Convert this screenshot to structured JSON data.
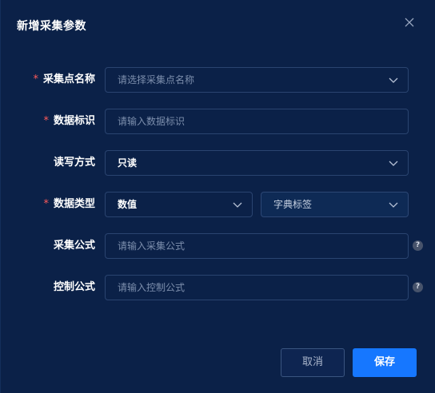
{
  "dialog": {
    "title": "新增采集参数",
    "close_icon": "close-icon"
  },
  "form": {
    "collect_point": {
      "label": "采集点名称",
      "required": "*",
      "placeholder": "请选择采集点名称"
    },
    "data_identifier": {
      "label": "数据标识",
      "required": "*",
      "placeholder": "请输入数据标识"
    },
    "rw_mode": {
      "label": "读写方式",
      "value": "只读"
    },
    "data_type": {
      "label": "数据类型",
      "required": "*",
      "value": "数值",
      "dict_placeholder": "字典标签"
    },
    "collect_formula": {
      "label": "采集公式",
      "placeholder": "请输入采集公式",
      "help": "?"
    },
    "control_formula": {
      "label": "控制公式",
      "placeholder": "请输入控制公式",
      "help": "?"
    }
  },
  "footer": {
    "cancel_label": "取消",
    "save_label": "保存"
  },
  "colors": {
    "background": "#0b2148",
    "primary": "#1677ff",
    "required": "#ff5a5a"
  }
}
